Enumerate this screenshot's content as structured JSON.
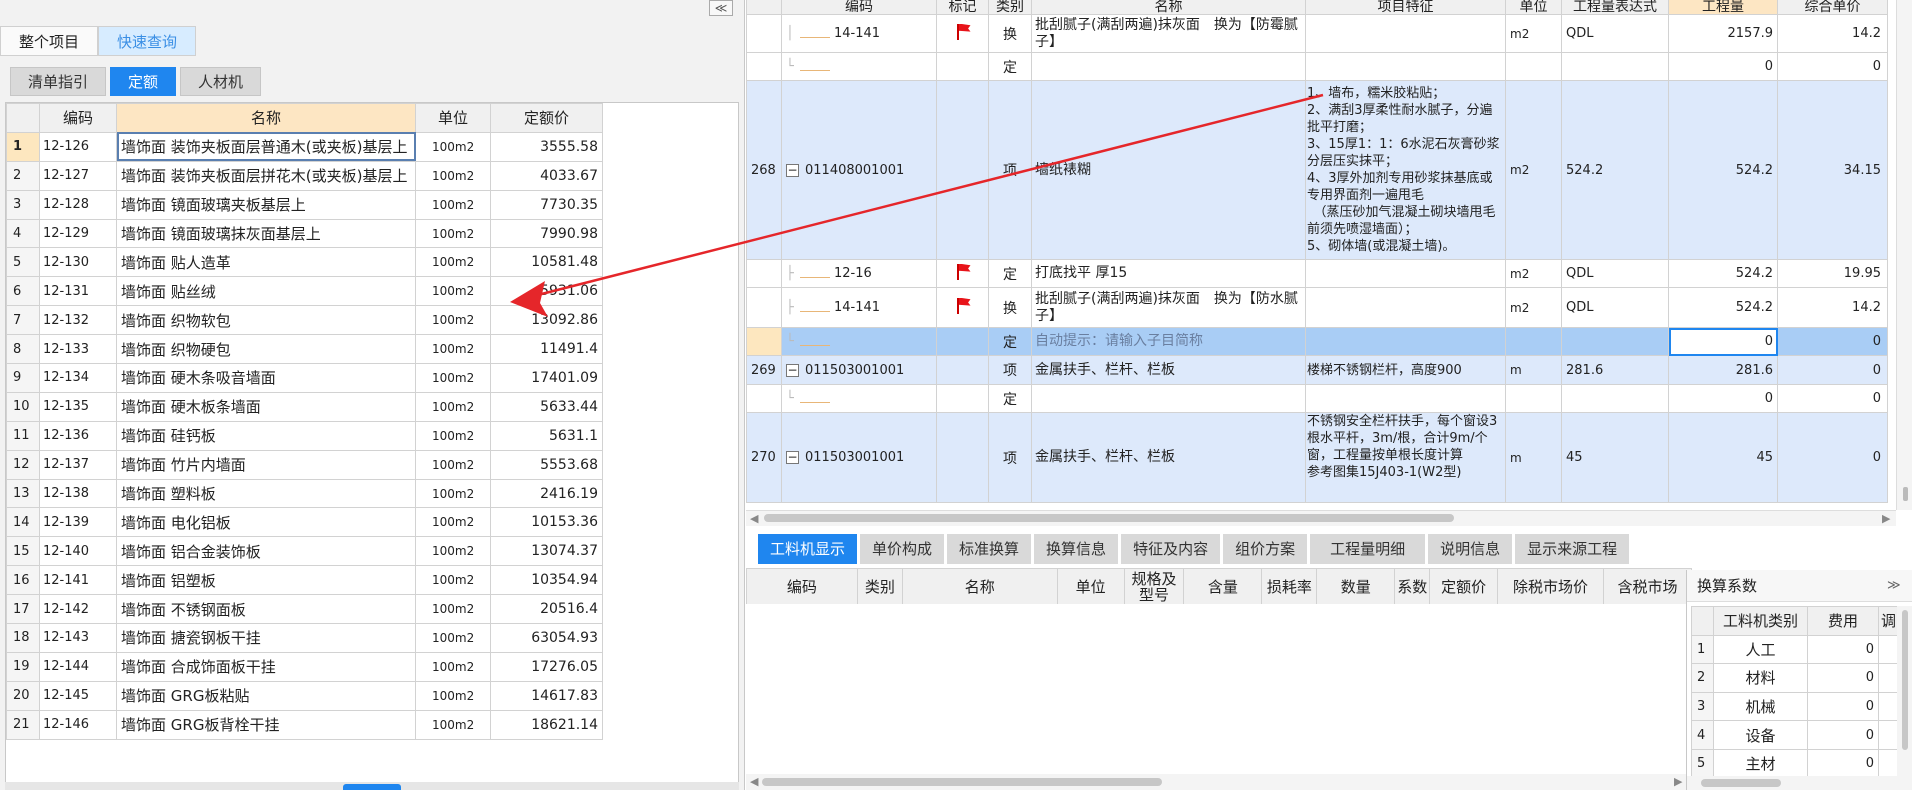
{
  "left_panel": {
    "collapse": "≪",
    "top_tabs": [
      "整个项目",
      "快速查询"
    ],
    "sub_tabs": [
      "清单指引",
      "定额",
      "人材机"
    ],
    "columns": [
      "编码",
      "名称",
      "单位",
      "定额价"
    ],
    "rows": [
      {
        "idx": "1",
        "code": "12-126",
        "name": "墙饰面 装饰夹板面层普通木(或夹板)基层上",
        "unit": "100m2",
        "price": "3555.58"
      },
      {
        "idx": "2",
        "code": "12-127",
        "name": "墙饰面 装饰夹板面层拼花木(或夹板)基层上",
        "unit": "100m2",
        "price": "4033.67"
      },
      {
        "idx": "3",
        "code": "12-128",
        "name": "墙饰面 镜面玻璃夹板基层上",
        "unit": "100m2",
        "price": "7730.35"
      },
      {
        "idx": "4",
        "code": "12-129",
        "name": "墙饰面 镜面玻璃抹灰面基层上",
        "unit": "100m2",
        "price": "7990.98"
      },
      {
        "idx": "5",
        "code": "12-130",
        "name": "墙饰面 贴人造革",
        "unit": "100m2",
        "price": "10581.48"
      },
      {
        "idx": "6",
        "code": "12-131",
        "name": "墙饰面 贴丝绒",
        "unit": "100m2",
        "price": "5931.06"
      },
      {
        "idx": "7",
        "code": "12-132",
        "name": "墙饰面 织物软包",
        "unit": "100m2",
        "price": "13092.86"
      },
      {
        "idx": "8",
        "code": "12-133",
        "name": "墙饰面 织物硬包",
        "unit": "100m2",
        "price": "11491.4"
      },
      {
        "idx": "9",
        "code": "12-134",
        "name": "墙饰面 硬木条吸音墙面",
        "unit": "100m2",
        "price": "17401.09"
      },
      {
        "idx": "10",
        "code": "12-135",
        "name": "墙饰面 硬木板条墙面",
        "unit": "100m2",
        "price": "5633.44"
      },
      {
        "idx": "11",
        "code": "12-136",
        "name": "墙饰面 硅钙板",
        "unit": "100m2",
        "price": "5631.1"
      },
      {
        "idx": "12",
        "code": "12-137",
        "name": "墙饰面 竹片内墙面",
        "unit": "100m2",
        "price": "5553.68"
      },
      {
        "idx": "13",
        "code": "12-138",
        "name": "墙饰面 塑料板",
        "unit": "100m2",
        "price": "2416.19"
      },
      {
        "idx": "14",
        "code": "12-139",
        "name": "墙饰面 电化铝板",
        "unit": "100m2",
        "price": "10153.36"
      },
      {
        "idx": "15",
        "code": "12-140",
        "name": "墙饰面 铝合金装饰板",
        "unit": "100m2",
        "price": "13074.37"
      },
      {
        "idx": "16",
        "code": "12-141",
        "name": "墙饰面 铝塑板",
        "unit": "100m2",
        "price": "10354.94"
      },
      {
        "idx": "17",
        "code": "12-142",
        "name": "墙饰面 不锈钢面板",
        "unit": "100m2",
        "price": "20516.4"
      },
      {
        "idx": "18",
        "code": "12-143",
        "name": "墙饰面 搪瓷钢板干挂",
        "unit": "100m2",
        "price": "63054.93"
      },
      {
        "idx": "19",
        "code": "12-144",
        "name": "墙饰面 合成饰面板干挂",
        "unit": "100m2",
        "price": "17276.05"
      },
      {
        "idx": "20",
        "code": "12-145",
        "name": "墙饰面 GRG板粘贴",
        "unit": "100m2",
        "price": "14617.83"
      },
      {
        "idx": "21",
        "code": "12-146",
        "name": "墙饰面 GRG板背栓干挂",
        "unit": "100m2",
        "price": "18621.14"
      }
    ]
  },
  "right_grid": {
    "columns": [
      "",
      "编码",
      "标记",
      "类别",
      "名称",
      "项目特征",
      "单位",
      "工程量表达式",
      "工程量",
      "综合单价"
    ],
    "rows": {
      "r1": {
        "code": "14-141",
        "type": "换",
        "name": "批刮腻子(满刮两遍)抹灰面　换为【防霉腻子】",
        "unit": "m2",
        "expr": "QDL",
        "qty": "2157.9",
        "price": "14.2"
      },
      "r2": {
        "type": "定",
        "qty": "0",
        "price": "0"
      },
      "r3": {
        "idx": "268",
        "code": "011408001001",
        "type": "项",
        "name": "墙纸裱糊",
        "feature": "1、墙布，糯米胶粘贴；\n2、满刮3厚柔性耐水腻子，分遍批平打磨；\n3、15厚1：1：6水泥石灰膏砂浆分层压实抹平；\n4、3厚外加剂专用砂浆抹基底或专用界面剂一遍甩毛\n　（蒸压砂加气混凝土砌块墙甩毛前须先喷湿墙面）；\n5、砌体墙(或混凝土墙)。",
        "unit": "m2",
        "expr": "524.2",
        "qty": "524.2",
        "price": "34.15"
      },
      "r4": {
        "code": "12-16",
        "type": "定",
        "name": "打底找平 厚15",
        "unit": "m2",
        "expr": "QDL",
        "qty": "524.2",
        "price": "19.95"
      },
      "r5": {
        "code": "14-141",
        "type": "换",
        "name": "批刮腻子(满刮两遍)抹灰面　换为【防水腻子】",
        "unit": "m2",
        "expr": "QDL",
        "qty": "524.2",
        "price": "14.2"
      },
      "r6": {
        "type": "定",
        "name": "自动提示：请输入子目简称",
        "qty": "0",
        "price": "0"
      },
      "r7": {
        "idx": "269",
        "code": "011503001001",
        "type": "项",
        "name": "金属扶手、栏杆、栏板",
        "feature": "楼梯不锈钢栏杆，高度900",
        "unit": "m",
        "expr": "281.6",
        "qty": "281.6",
        "price": "0"
      },
      "r8": {
        "type": "定",
        "qty": "0",
        "price": "0"
      },
      "r9": {
        "idx": "270",
        "code": "011503001001",
        "type": "项",
        "name": "金属扶手、栏杆、栏板",
        "feature": "不锈钢安全栏杆扶手，每个窗设3根水平杆，3m/根，合计9m/个窗，工程量按单根长度计算\n参考图集15J403-1(W2型)",
        "unit": "m",
        "expr": "45",
        "qty": "45",
        "price": "0"
      }
    }
  },
  "bottom": {
    "tabs": [
      "工料机显示",
      "单价构成",
      "标准换算",
      "换算信息",
      "特征及内容",
      "组价方案",
      "工程量明细",
      "说明信息",
      "显示来源工程"
    ],
    "columns": [
      "编码",
      "类别",
      "名称",
      "单位",
      "规格及型号",
      "含量",
      "损耗率",
      "数量",
      "系数",
      "定额价",
      "除税市场价",
      "含税市场"
    ]
  },
  "coef_panel": {
    "title": "换算系数",
    "expand": "≫",
    "columns": [
      "工料机类别",
      "费用",
      "调"
    ],
    "rows": [
      {
        "idx": "1",
        "name": "人工",
        "value": "0"
      },
      {
        "idx": "2",
        "name": "材料",
        "value": "0"
      },
      {
        "idx": "3",
        "name": "机械",
        "value": "0"
      },
      {
        "idx": "4",
        "name": "设备",
        "value": "0"
      },
      {
        "idx": "5",
        "name": "主材",
        "value": "0"
      }
    ]
  },
  "colors": {
    "accent": "#1f86ef",
    "header_highlight": "#fde6c3",
    "row_blue": "#dde9fb",
    "row_selected": "#a9cdf5",
    "annotation_arrow": "#e5262a"
  }
}
